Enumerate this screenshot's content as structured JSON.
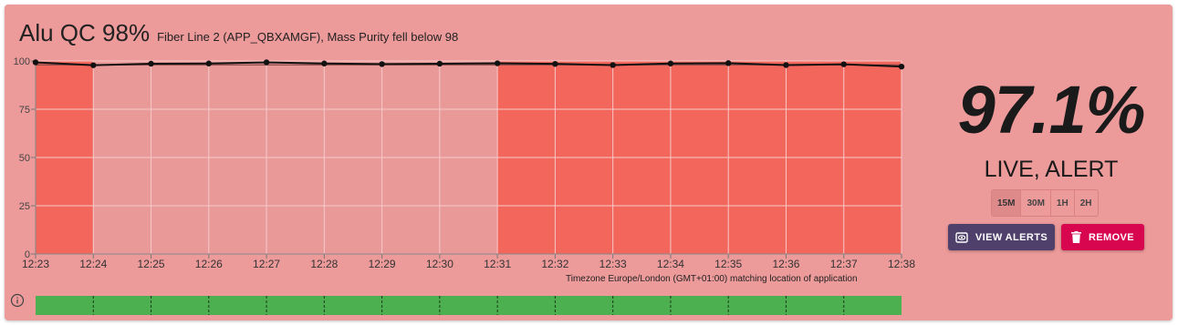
{
  "header": {
    "title": "Alu QC 98%",
    "subtitle": "Fiber Line 2 (APP_QBXAMGF), Mass Purity fell below 98"
  },
  "timezone_note": "Timezone Europe/London (GMT+01:00) matching location of application",
  "live_panel": {
    "value": "97.1%",
    "status": "LIVE, ALERT",
    "ranges": [
      "15M",
      "30M",
      "1H",
      "2H"
    ],
    "active_range": "15M",
    "view_alerts_label": "VIEW ALERTS",
    "remove_label": "REMOVE"
  },
  "colors": {
    "card_bg": "#ed9a9a",
    "alert_fill": "#f2665c",
    "ok_fill": "#ea9999",
    "status_ok": "#4caf50",
    "view_button": "#4e3f6b",
    "remove_button": "#d7064f"
  },
  "icons": {
    "info": "info-icon",
    "view_alerts": "view-icon",
    "remove": "trash-icon"
  },
  "chart_data": {
    "type": "line",
    "categories": [
      "12:23",
      "12:24",
      "12:25",
      "12:26",
      "12:27",
      "12:28",
      "12:29",
      "12:30",
      "12:31",
      "12:32",
      "12:33",
      "12:34",
      "12:35",
      "12:36",
      "12:37",
      "12:38"
    ],
    "series": [
      {
        "values": [
          99.3,
          97.8,
          98.6,
          98.7,
          99.3,
          98.7,
          98.4,
          98.6,
          98.8,
          98.5,
          97.9,
          98.7,
          98.9,
          97.9,
          98.3,
          97.1
        ]
      }
    ],
    "yticks": [
      0,
      25,
      50,
      75,
      100
    ],
    "ylim": [
      0,
      100
    ],
    "threshold": 98,
    "alert_intervals": [
      [
        0,
        1
      ],
      [
        8,
        15
      ]
    ],
    "status_bar": "ok",
    "grid": true
  }
}
